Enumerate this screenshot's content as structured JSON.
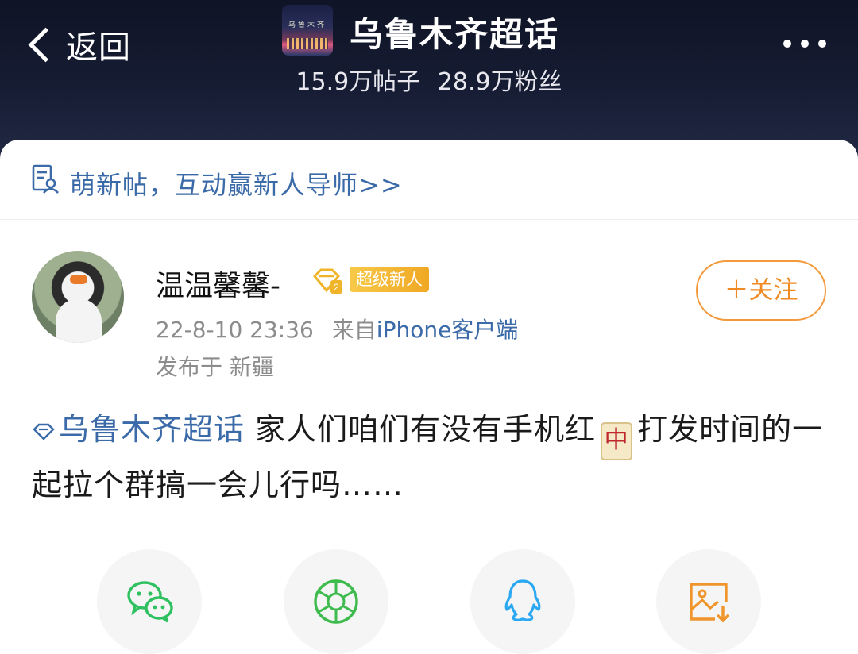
{
  "header": {
    "back_label": "返回",
    "topic_title": "乌鲁木齐超话",
    "thumb_text": "乌鲁木齐",
    "posts_count": "15.9万帖子",
    "fans_count": "28.9万粉丝"
  },
  "banner": {
    "text": "萌新帖，互动赢新人导师>>"
  },
  "post": {
    "username": "温温馨馨-",
    "level_badge": "超级新人",
    "timestamp": "22-8-10 23:36",
    "source_prefix": "来自",
    "source": "iPhone客户端",
    "location": "发布于 新疆",
    "follow_label": "＋关注",
    "topic_tag": "乌鲁木齐超话",
    "text_part1": " 家人们咱们有没有手机红",
    "emoji": "中",
    "text_part2": "打发时间的一起拉个群搞一会儿行吗……"
  },
  "share": {
    "icons": [
      "wechat-icon",
      "moments-icon",
      "qq-icon",
      "save-image-icon"
    ]
  },
  "colors": {
    "accent_blue": "#3b6aa8",
    "follow_orange": "#f08a24",
    "header_bg": "#161c33"
  }
}
